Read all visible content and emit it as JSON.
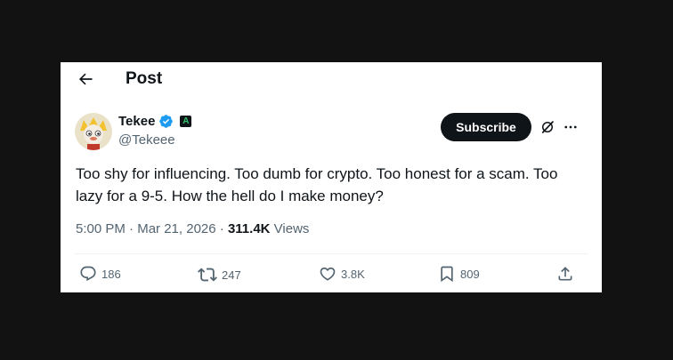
{
  "header": {
    "title": "Post"
  },
  "author": {
    "name": "Tekee",
    "handle": "@Tekeee",
    "affiliate_badge": "A"
  },
  "subscribe_label": "Subscribe",
  "tweet": {
    "text": "Too shy for influencing. Too dumb for crypto. Too honest for a scam. Too lazy for a 9-5. How the hell do I make money?",
    "time": "5:00 PM",
    "sep1": " · ",
    "date": "Mar 21, 2026",
    "sep2": " · ",
    "views": "311.4K",
    "views_label": " Views"
  },
  "actions": {
    "replies": "186",
    "reposts": "247",
    "likes": "3.8K",
    "bookmarks": "809"
  },
  "colors": {
    "background": "#121212",
    "text_primary": "#0f1419",
    "text_secondary": "#536471",
    "verified_blue": "#1d9bf0",
    "subscribe_bg": "#0f1419"
  },
  "icons": {
    "back": "arrow-left-icon",
    "verified": "verified-badge-icon",
    "grok": "grok-icon",
    "more": "more-dots-icon",
    "reply": "reply-icon",
    "repost": "repost-icon",
    "like": "heart-icon",
    "bookmark": "bookmark-icon",
    "share": "share-icon"
  }
}
